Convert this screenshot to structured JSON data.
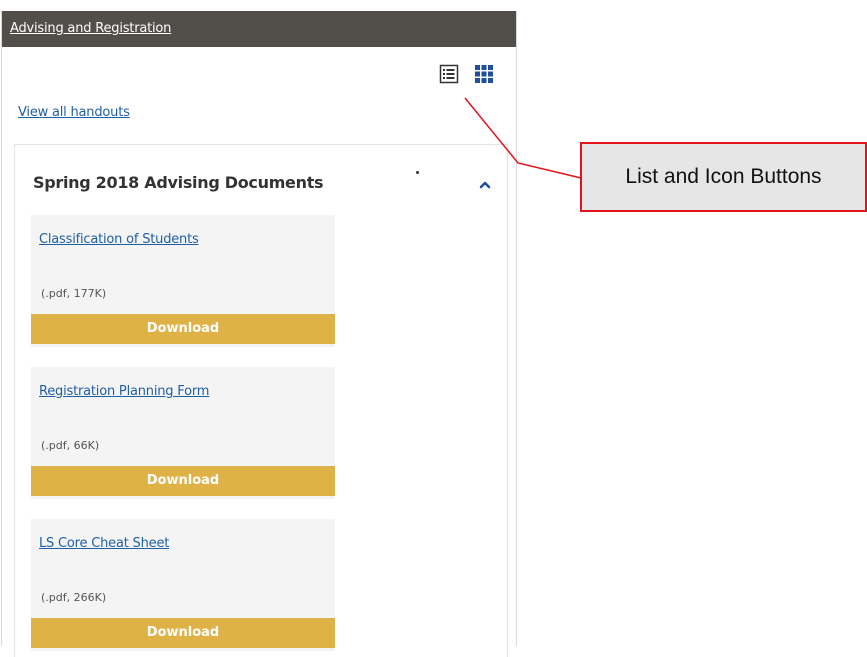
{
  "panel": {
    "title": "Advising and Registration",
    "view_all_label": "View all handouts",
    "view_buttons": [
      {
        "name": "list-view",
        "icon": "list-icon"
      },
      {
        "name": "grid-view",
        "icon": "grid-icon"
      }
    ],
    "accent_color": "#1f5fa6",
    "download_color": "#dfb247"
  },
  "section": {
    "title": "Spring 2018 Advising Documents",
    "collapse_icon": "chevron-up-icon",
    "documents": [
      {
        "title": "Classification of Students",
        "meta": "(.pdf, 177K)",
        "download_label": "Download"
      },
      {
        "title": "Registration Planning Form",
        "meta": "(.pdf, 66K)",
        "download_label": "Download"
      },
      {
        "title": "LS Core Cheat Sheet",
        "meta": "(.pdf, 266K)",
        "download_label": "Download"
      }
    ]
  },
  "annotation": {
    "callout_text": "List and Icon Buttons",
    "border_color": "#e0141a"
  }
}
